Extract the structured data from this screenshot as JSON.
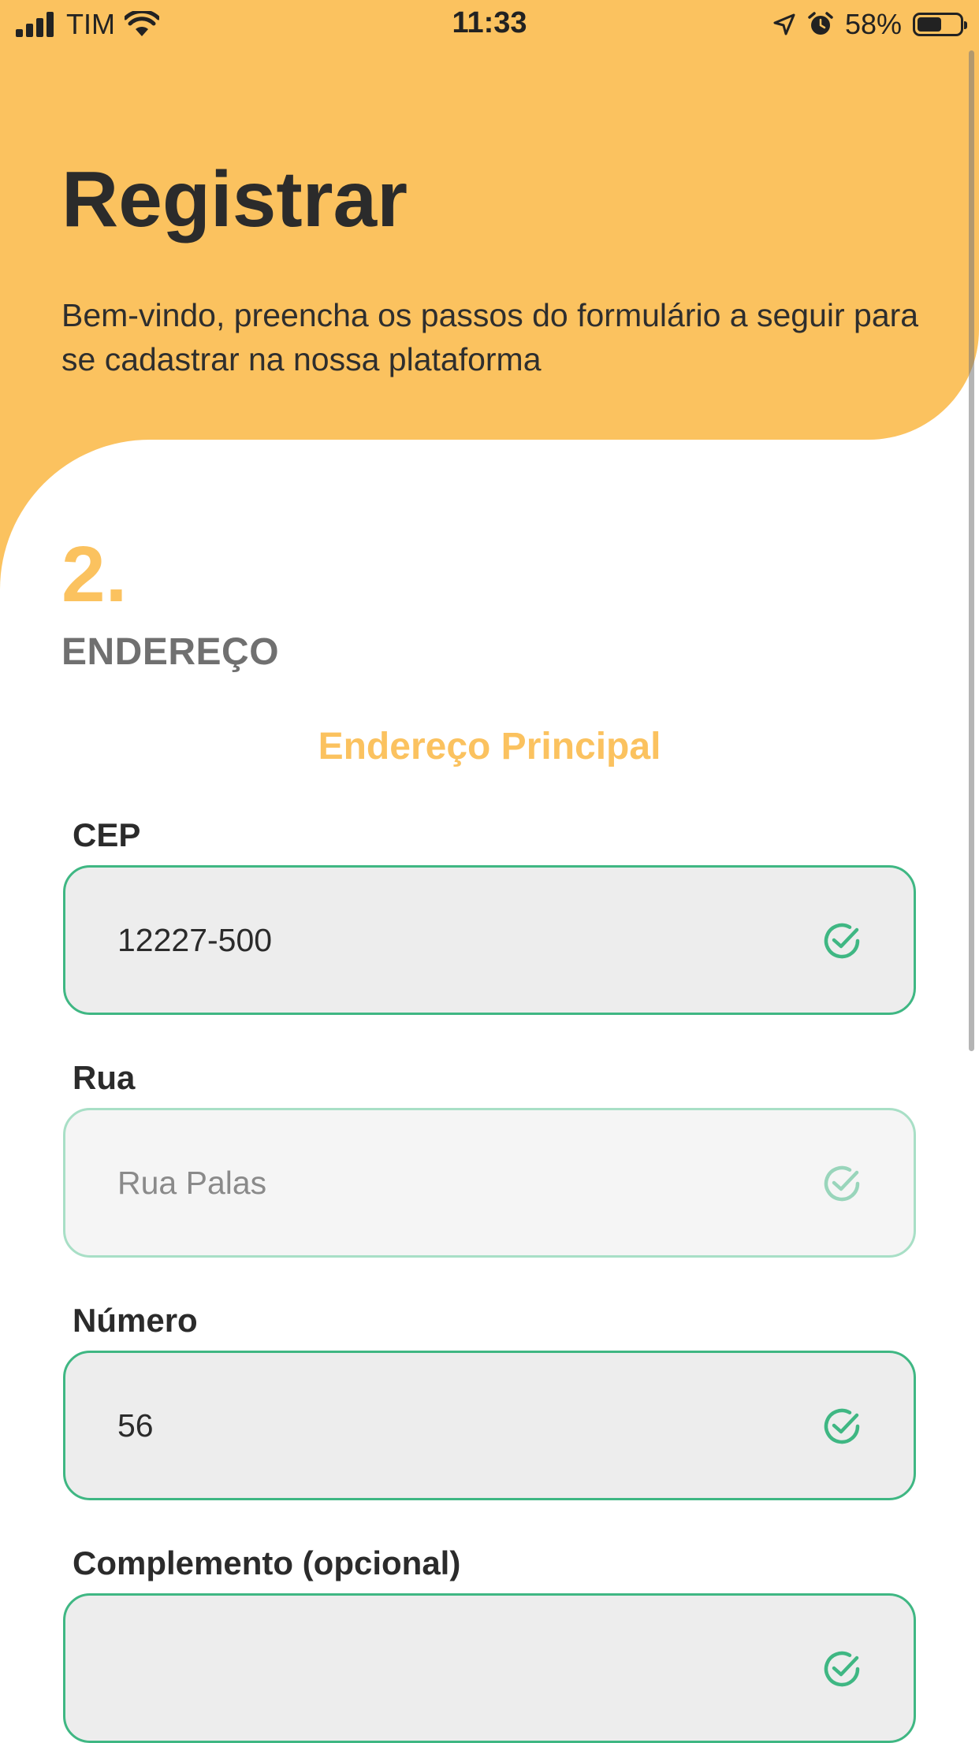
{
  "status_bar": {
    "carrier": "TIM",
    "time": "11:33",
    "battery_percent": "58%",
    "battery_level": 0.58,
    "icons": [
      "signal-icon",
      "wifi-icon",
      "location-arrow-icon",
      "alarm-icon",
      "battery-icon"
    ]
  },
  "header": {
    "title": "Registrar",
    "subtitle": "Bem-vindo, preencha os passos do formulário a seguir para se cadastrar na nossa plataforma"
  },
  "step": {
    "number": "2.",
    "title": "ENDEREÇO"
  },
  "section": {
    "title": "Endereço Principal"
  },
  "fields": {
    "cep": {
      "label": "CEP",
      "value": "12227-500",
      "status": "valid"
    },
    "rua": {
      "label": "Rua",
      "value": "Rua Palas",
      "status": "valid-disabled"
    },
    "numero": {
      "label": "Número",
      "value": "56",
      "status": "valid"
    },
    "complemento": {
      "label": "Complemento (opcional)",
      "value": "",
      "status": "valid"
    }
  },
  "colors": {
    "accent": "#fbc25f",
    "success": "#3fb783",
    "text": "#2b2b2b",
    "muted": "#707070"
  }
}
